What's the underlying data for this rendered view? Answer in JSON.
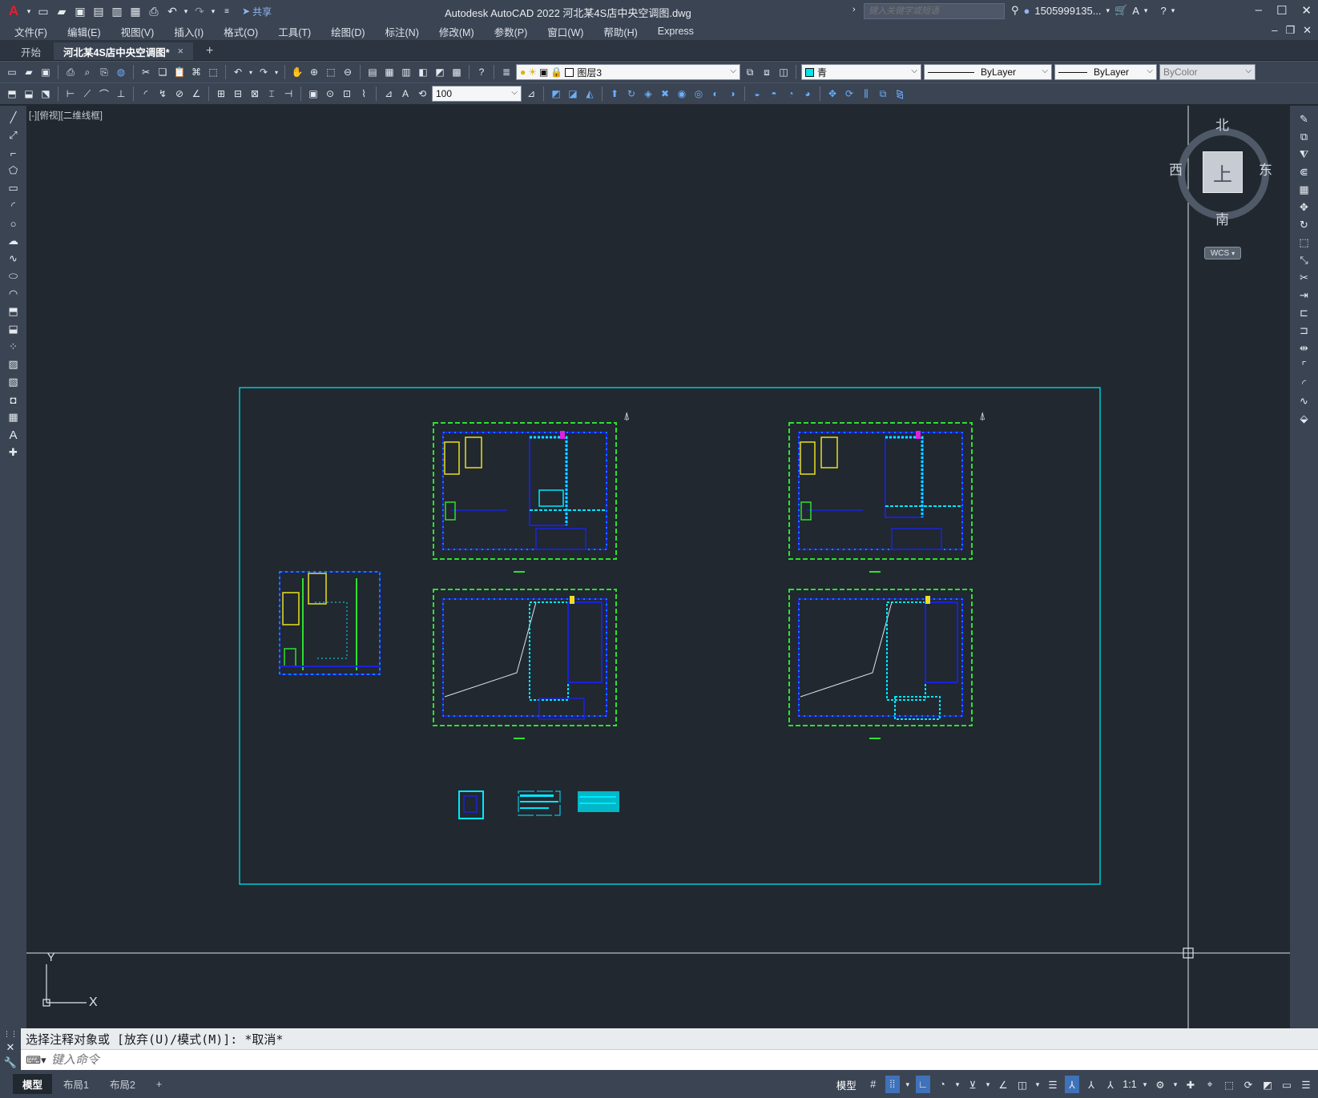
{
  "app": {
    "title": "Autodesk AutoCAD 2022    河北某4S店中央空调图.dwg",
    "logo": "A",
    "share_label": "共享"
  },
  "search": {
    "placeholder": "键入关键字或短语"
  },
  "user": {
    "name": "1505999135..."
  },
  "menu": [
    "文件(F)",
    "编辑(E)",
    "视图(V)",
    "插入(I)",
    "格式(O)",
    "工具(T)",
    "绘图(D)",
    "标注(N)",
    "修改(M)",
    "参数(P)",
    "窗口(W)",
    "帮助(H)",
    "Express"
  ],
  "tabs": {
    "start": "开始",
    "doc": "河北某4S店中央空调图*",
    "close": "×",
    "new": "+"
  },
  "toolbar": {
    "layer_name": "图层3",
    "color_name": "青",
    "color_hex": "#00e5e5",
    "linetype": "ByLayer",
    "lineweight": "ByLayer",
    "plotstyle": "ByColor",
    "scale_value": "100"
  },
  "viewport": {
    "label": "[-][俯视][二维线框]"
  },
  "viewcube": {
    "top": "上",
    "north": "北",
    "south": "南",
    "east": "东",
    "west": "西",
    "wcs": "WCS"
  },
  "ucs": {
    "x": "X",
    "y": "Y"
  },
  "command": {
    "history": "选择注释对象或 [放弃(U)/模式(M)]: *取消*",
    "placeholder": "键入命令"
  },
  "layouts": [
    "模型",
    "布局1",
    "布局2"
  ],
  "layout_add": "+",
  "status": {
    "model_label": "模型",
    "scale": "1:1"
  },
  "colors": {
    "background": "#212830",
    "chrome": "#3b4453",
    "drawing_border": "#00c8d0",
    "axis_green": "#2de02d",
    "walls_blue": "#1a22d8",
    "duct_cyan": "#00e8ff",
    "yellow": "#e8e020",
    "magenta": "#e020e0"
  }
}
